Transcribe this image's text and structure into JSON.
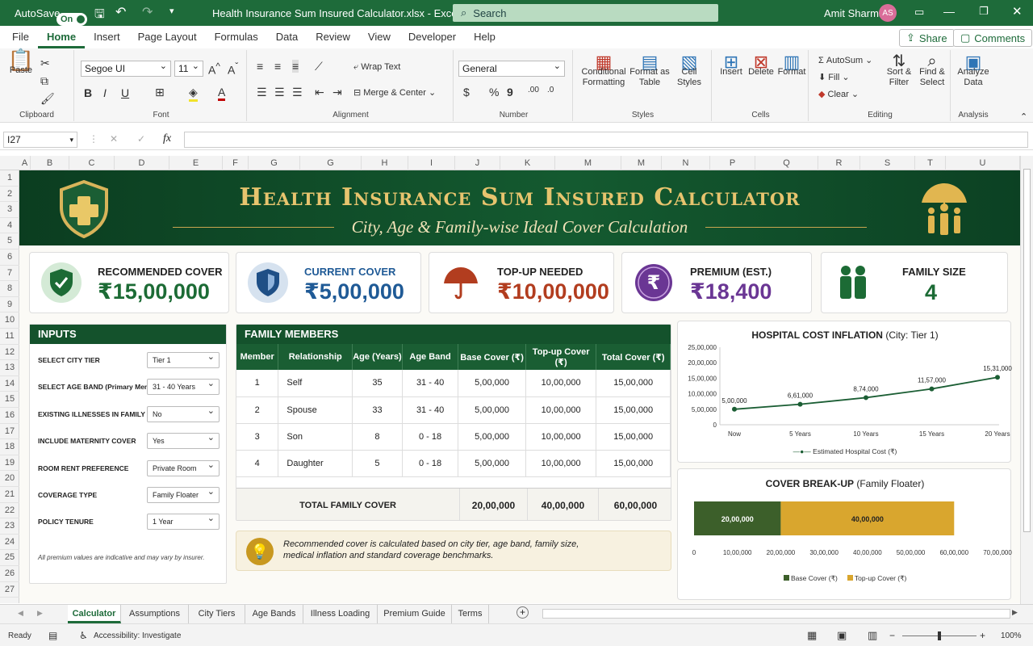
{
  "titlebar": {
    "autosave_label": "AutoSave",
    "autosave_state": "On",
    "file_title": "Health Insurance Sum Insured Calculator.xlsx  -  Excel",
    "search_placeholder": "Search",
    "user_name": "Amit Sharma",
    "user_initials": "AS"
  },
  "menu": [
    "File",
    "Home",
    "Insert",
    "Page Layout",
    "Formulas",
    "Data",
    "Review",
    "View",
    "Developer",
    "Help"
  ],
  "menu_active": "Home",
  "share_label": "Share",
  "comments_label": "Comments",
  "ribbon": {
    "clipboard": {
      "paste": "Paste",
      "label": "Clipboard"
    },
    "font": {
      "name": "Segoe UI",
      "size": "11",
      "label": "Font"
    },
    "alignment": {
      "wrap": "Wrap Text",
      "merge": "Merge & Center",
      "label": "Alignment"
    },
    "number": {
      "format": "General",
      "label": "Number"
    },
    "styles": {
      "cond": "Conditional Formatting",
      "table": "Format as Table",
      "cell": "Cell Styles",
      "label": "Styles"
    },
    "cells": {
      "insert": "Insert",
      "delete": "Delete",
      "format": "Format",
      "label": "Cells"
    },
    "editing": {
      "autosum": "AutoSum",
      "fill": "Fill",
      "clear": "Clear",
      "sort": "Sort & Filter",
      "find": "Find & Select",
      "label": "Editing"
    },
    "analysis": {
      "analyze": "Analyze Data",
      "label": "Analysis"
    }
  },
  "namebox": "I27",
  "columns": [
    "A",
    "B",
    "C",
    "D",
    "E",
    "F",
    "G",
    "G",
    "H",
    "I",
    "J",
    "K",
    "M",
    "M",
    "N",
    "P",
    "Q",
    "R",
    "S",
    "T",
    "U"
  ],
  "rows": [
    "1",
    "2",
    "3",
    "4",
    "5",
    "6",
    "7",
    "8",
    "9",
    "10",
    "11",
    "12",
    "13",
    "14",
    "15",
    "16",
    "17",
    "18",
    "19",
    "20",
    "21",
    "22",
    "23",
    "24",
    "25",
    "26",
    "27"
  ],
  "banner": {
    "title": "Health Insurance Sum Insured Calculator",
    "subtitle": "City, Age & Family-wise Ideal Cover Calculation"
  },
  "kpis": [
    {
      "label": "RECOMMENDED COVER",
      "value": "₹15,00,000",
      "color": "#1c6b35",
      "icon": "shield-check-icon"
    },
    {
      "label": "CURRENT COVER",
      "value": "₹5,00,000",
      "color": "#1f5a96",
      "icon": "shield-icon"
    },
    {
      "label": "TOP-UP NEEDED",
      "value": "₹10,00,000",
      "color": "#b23d1f",
      "icon": "umbrella-icon"
    },
    {
      "label": "PREMIUM (EST.)",
      "value": "₹18,400",
      "color": "#6a3694",
      "icon": "rupee-icon"
    },
    {
      "label": "FAMILY SIZE",
      "value": "4",
      "color": "#1c6b35",
      "icon": "family-icon"
    }
  ],
  "inputs": {
    "title": "INPUTS",
    "items": [
      {
        "label": "SELECT CITY TIER",
        "value": "Tier 1"
      },
      {
        "label": "SELECT AGE BAND (Primary Member)",
        "value": "31 - 40 Years"
      },
      {
        "label": "EXISTING ILLNESSES IN FAMILY",
        "value": "No"
      },
      {
        "label": "INCLUDE MATERNITY COVER",
        "value": "Yes"
      },
      {
        "label": "ROOM RENT PREFERENCE",
        "value": "Private Room"
      },
      {
        "label": "COVERAGE TYPE",
        "value": "Family Floater"
      },
      {
        "label": "POLICY TENURE",
        "value": "1 Year"
      }
    ],
    "note": "All premium values are indicative and may vary by insurer."
  },
  "family": {
    "title": "FAMILY MEMBERS",
    "headers": [
      "Member",
      "Relationship",
      "Age (Years)",
      "Age Band",
      "Base Cover (₹)",
      "Top-up Cover (₹)",
      "Total Cover (₹)"
    ],
    "rows": [
      [
        "1",
        "Self",
        "35",
        "31 - 40",
        "5,00,000",
        "10,00,000",
        "15,00,000"
      ],
      [
        "2",
        "Spouse",
        "33",
        "31 - 40",
        "5,00,000",
        "10,00,000",
        "15,00,000"
      ],
      [
        "3",
        "Son",
        "8",
        "0 - 18",
        "5,00,000",
        "10,00,000",
        "15,00,000"
      ],
      [
        "4",
        "Daughter",
        "5",
        "0 - 18",
        "5,00,000",
        "10,00,000",
        "15,00,000"
      ]
    ],
    "total_label": "TOTAL FAMILY COVER",
    "total_base": "20,00,000",
    "total_topup": "40,00,000",
    "total_cover": "60,00,000",
    "info": "Recommended cover is calculated based on city tier, age band, family size, medical inflation and standard coverage benchmarks."
  },
  "chart1": {
    "title": "HOSPITAL COST INFLATION",
    "title_suffix": "(City: Tier 1)",
    "legend": "Estimated Hospital Cost (₹)"
  },
  "chart2": {
    "title": "COVER BREAK-UP",
    "title_suffix": "(Family Floater)",
    "legend": [
      "Base Cover (₹)",
      "Top-up Cover (₹)"
    ]
  },
  "chart_data": [
    {
      "type": "line",
      "title": "HOSPITAL COST INFLATION (City: Tier 1)",
      "categories": [
        "Now",
        "5 Years",
        "10 Years",
        "15 Years",
        "20 Years"
      ],
      "series": [
        {
          "name": "Estimated Hospital Cost (₹)",
          "values": [
            500000,
            661000,
            874000,
            1157000,
            1531000
          ],
          "labels": [
            "5,00,000",
            "6,61,000",
            "8,74,000",
            "11,57,000",
            "15,31,000"
          ]
        }
      ],
      "ylim": [
        0,
        2500000
      ],
      "yticks": [
        "0",
        "5,00,000",
        "10,00,000",
        "15,00,000",
        "20,00,000",
        "25,00,000"
      ],
      "legend": "bottom"
    },
    {
      "type": "bar",
      "title": "COVER BREAK-UP (Family Floater)",
      "orientation": "horizontal-stacked",
      "series": [
        {
          "name": "Base Cover (₹)",
          "values": [
            2000000
          ],
          "label": "20,00,000",
          "color": "#3c5f2a"
        },
        {
          "name": "Top-up Cover (₹)",
          "values": [
            4000000
          ],
          "label": "40,00,000",
          "color": "#d9a62e"
        }
      ],
      "xlim": [
        0,
        7000000
      ],
      "xticks": [
        "0",
        "10,00,000",
        "20,00,000",
        "30,00,000",
        "40,00,000",
        "50,00,000",
        "60,00,000",
        "70,00,000"
      ],
      "legend": "bottom"
    }
  ],
  "sheets": [
    "Calculator",
    "Assumptions",
    "City Tiers",
    "Age Bands",
    "Illness Loading",
    "Premium Guide",
    "Terms"
  ],
  "sheet_active": "Calculator",
  "status": {
    "ready": "Ready",
    "accessibility": "Accessibility: Investigate",
    "zoom": "100%"
  }
}
